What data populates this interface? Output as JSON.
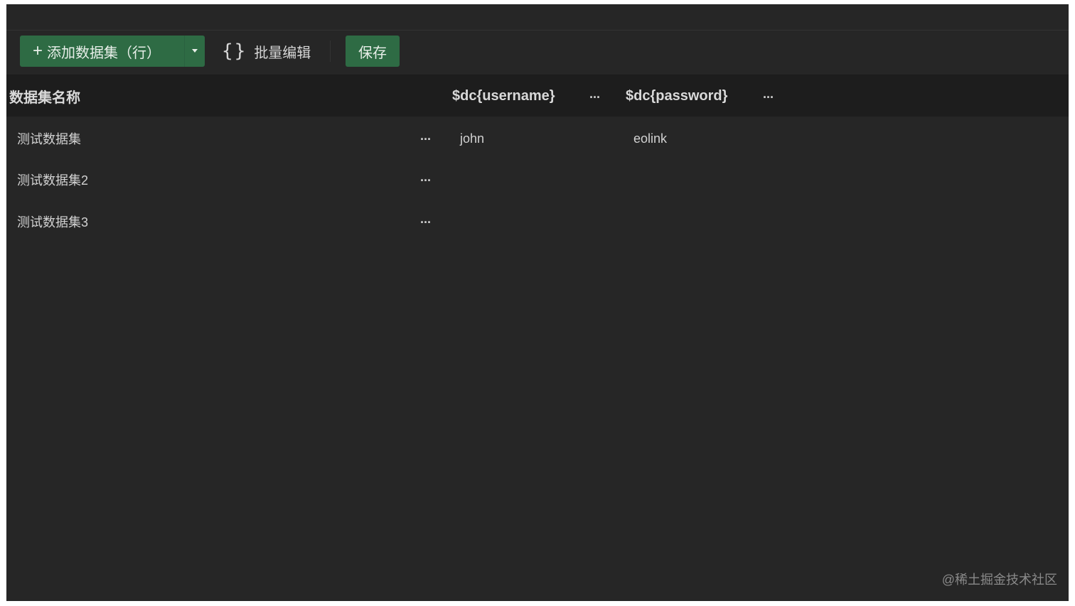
{
  "toolbar": {
    "add_label": "添加数据集（行）",
    "add_plus": "+",
    "batch_icon": "{}",
    "batch_label": "批量编辑",
    "save_label": "保存"
  },
  "table": {
    "columns": {
      "name": "数据集名称",
      "col1": "$dc{username}",
      "col2": "$dc{password}"
    },
    "more": "···",
    "rows": [
      {
        "name": "测试数据集",
        "username": "john",
        "password": "eolink"
      },
      {
        "name": "测试数据集2",
        "username": "",
        "password": ""
      },
      {
        "name": "测试数据集3",
        "username": "",
        "password": ""
      }
    ]
  },
  "watermark": "@稀土掘金技术社区",
  "colors": {
    "background": "#262626",
    "header_background": "#1d1d1d",
    "accent_green": "#2e6b44"
  },
  "icons": {
    "add": "plus-icon",
    "dropdown": "chevron-down-icon",
    "batch": "braces-icon",
    "more": "more-dots-icon"
  }
}
